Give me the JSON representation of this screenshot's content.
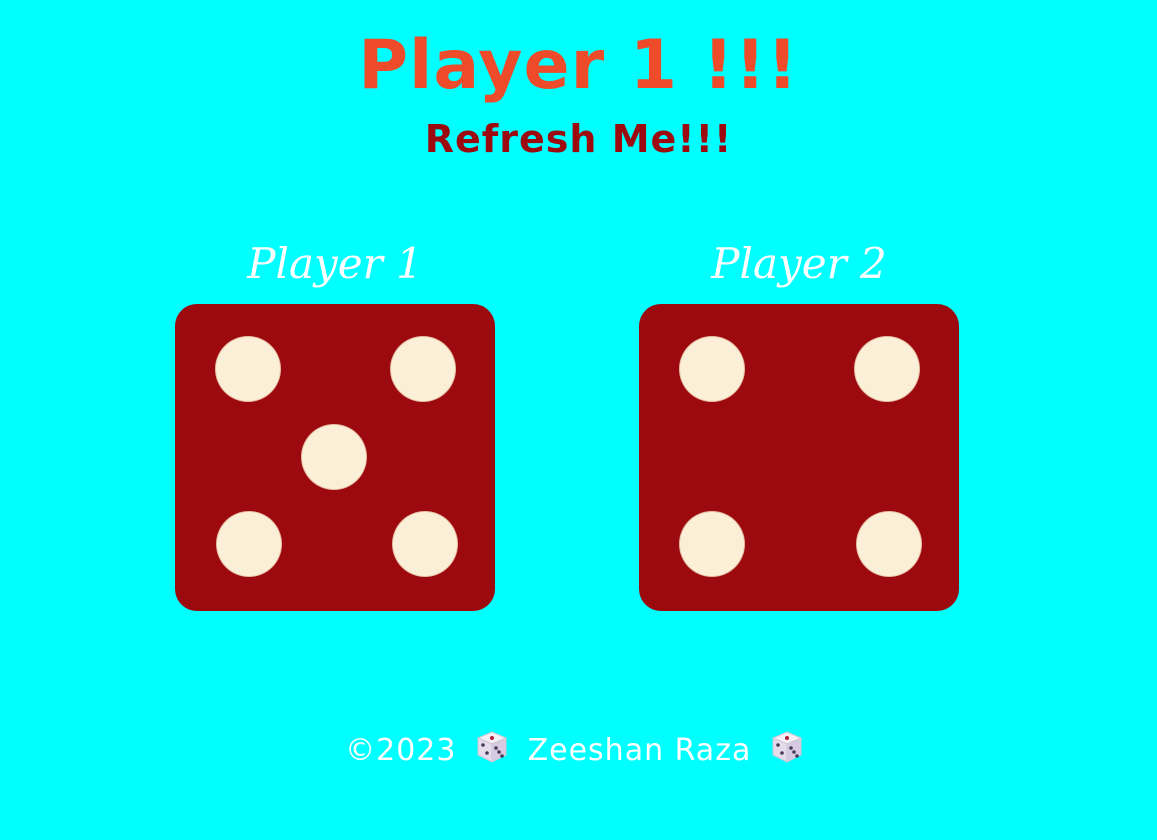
{
  "header": {
    "title": "Player 1 !!!",
    "subtitle": "Refresh Me!!!"
  },
  "players": [
    {
      "label": "Player 1",
      "die_value": 5
    },
    {
      "label": "Player 2",
      "die_value": 4
    }
  ],
  "footer": {
    "copyright": "©2023",
    "author": "Zeeshan Raza",
    "icon": "die-icon"
  },
  "colors": {
    "background": "#00ffff",
    "title": "#ee4b2b",
    "subtitle": "#9c0a0f",
    "die_face": "#9c0a10",
    "pip": "#fbefd8",
    "label": "#ffffff"
  }
}
